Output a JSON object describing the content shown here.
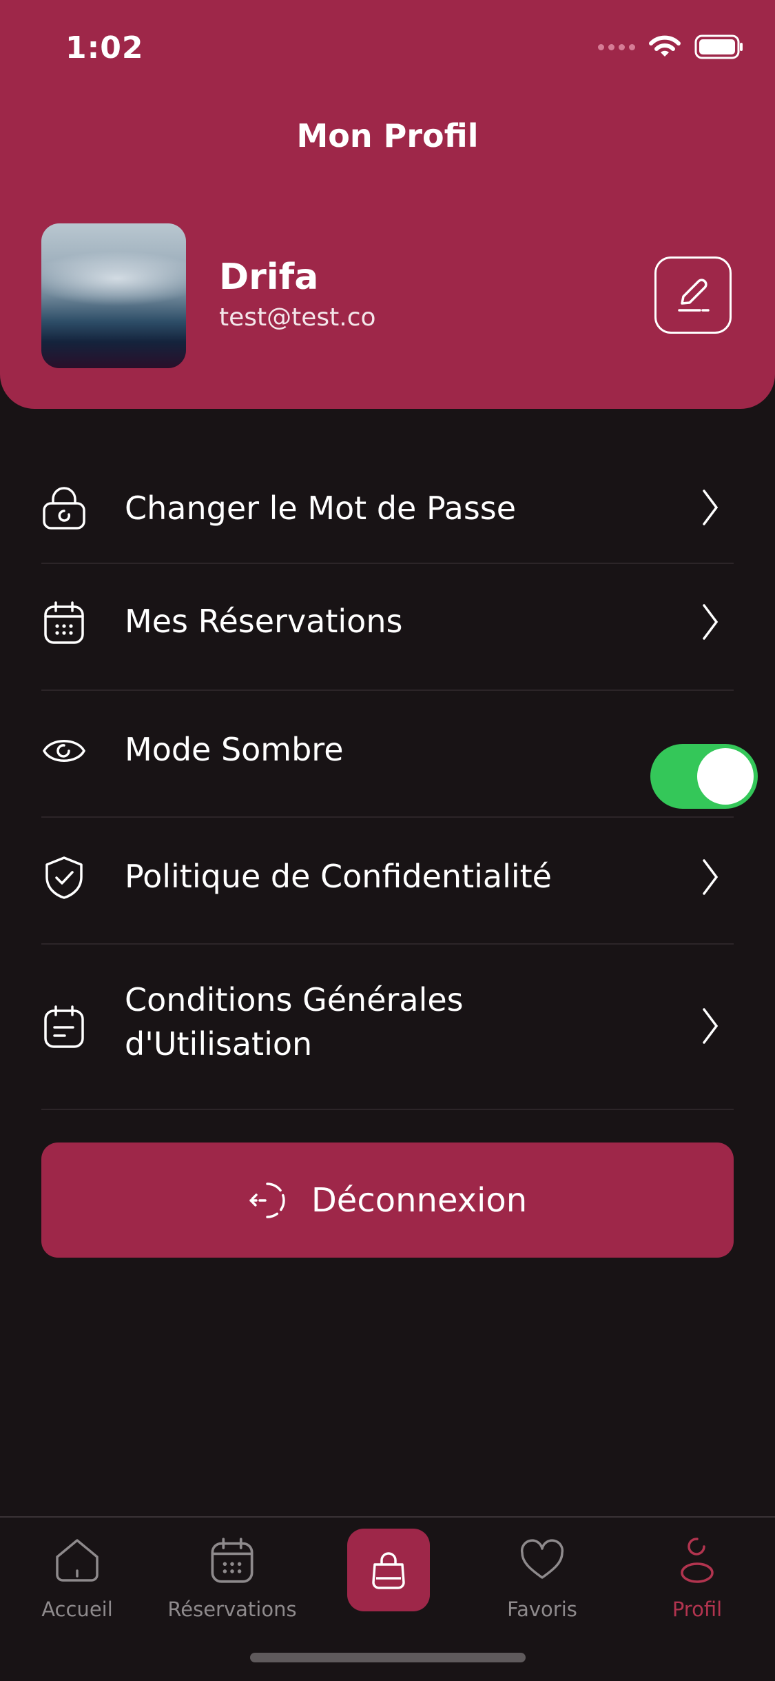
{
  "status_bar": {
    "time": "1:02"
  },
  "header": {
    "title": "Mon Profil"
  },
  "profile": {
    "name": "Drifa",
    "email": "test@test.co"
  },
  "menu": {
    "items": [
      {
        "label": "Changer le Mot de Passe",
        "icon": "lock-icon",
        "type": "link"
      },
      {
        "label": "Mes Réservations",
        "icon": "calendar-icon",
        "type": "link"
      },
      {
        "label": "Mode Sombre",
        "icon": "eye-icon",
        "type": "toggle",
        "toggle_on": true
      },
      {
        "label": "Politique de Confidentialité",
        "icon": "shield-check-icon",
        "type": "link"
      },
      {
        "label": "Conditions Générales d'Utilisation",
        "icon": "document-icon",
        "type": "link"
      }
    ]
  },
  "logout": {
    "label": "Déconnexion",
    "icon": "logout-icon"
  },
  "tabbar": {
    "tabs": [
      {
        "label": "Accueil",
        "icon": "home-icon",
        "active": false
      },
      {
        "label": "Réservations",
        "icon": "calendar-icon",
        "active": false
      },
      {
        "label": "",
        "icon": "bag-icon",
        "active": false
      },
      {
        "label": "Favoris",
        "icon": "heart-icon",
        "active": false
      },
      {
        "label": "Profil",
        "icon": "user-icon",
        "active": true
      }
    ]
  },
  "colors": {
    "brand": "#9e2749",
    "background": "#181315",
    "toggle_on": "#34c759",
    "tab_active": "#b2344f",
    "tab_inactive": "#8e8a8c"
  }
}
